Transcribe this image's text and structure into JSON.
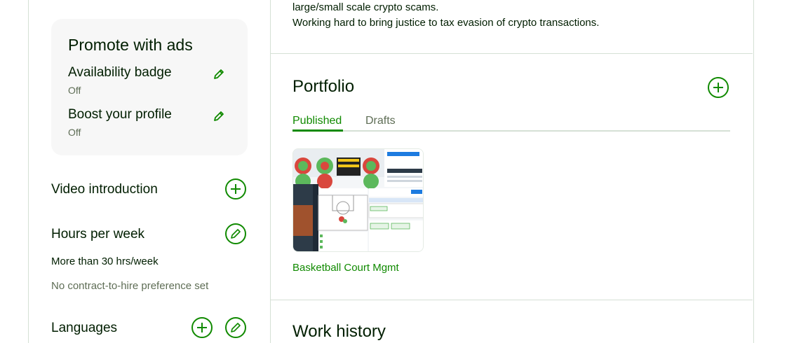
{
  "about": {
    "line1": "large/small scale crypto scams.",
    "line2": "Working hard to bring justice to tax evasion of crypto transactions."
  },
  "promote": {
    "title": "Promote with ads",
    "items": [
      {
        "label": "Availability badge",
        "status": "Off"
      },
      {
        "label": "Boost your profile",
        "status": "Off"
      }
    ]
  },
  "video": {
    "title": "Video introduction"
  },
  "hours": {
    "title": "Hours per week",
    "value": "More than 30 hrs/week",
    "preference": "No contract-to-hire preference set"
  },
  "languages": {
    "title": "Languages"
  },
  "portfolio": {
    "title": "Portfolio",
    "tabs": [
      {
        "label": "Published",
        "active": true
      },
      {
        "label": "Drafts",
        "active": false
      }
    ],
    "projects": [
      {
        "title": "Basketball Court Mgmt"
      }
    ]
  },
  "work_history": {
    "title": "Work history"
  },
  "colors": {
    "accent": "#108a00",
    "text": "#001e00",
    "muted": "#5e6d55",
    "border": "#d5e0d5",
    "card_bg": "#f7f7f7"
  }
}
